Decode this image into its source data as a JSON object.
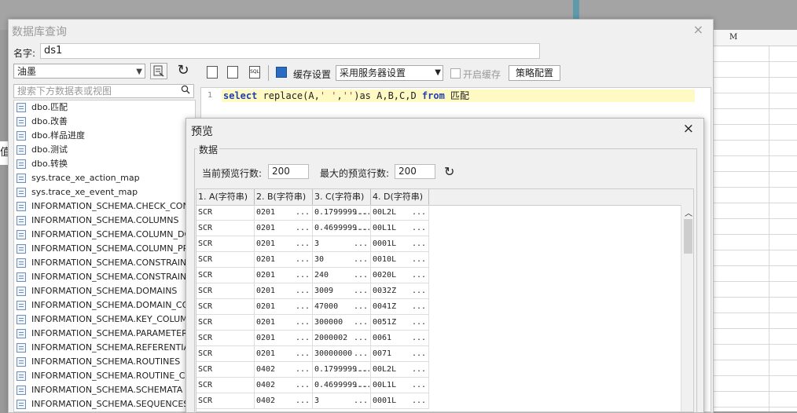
{
  "background": {
    "sheet_column_label": "M",
    "left_edge_text": "值"
  },
  "main_dialog": {
    "title": "数据库查询",
    "close_glyph": "×",
    "name_label": "名字:",
    "name_value": "ds1"
  },
  "left_panel": {
    "db_selected": "油墨",
    "search_placeholder": "搜索下方数据表或视图",
    "tables": [
      "dbo.匹配",
      "dbo.改善",
      "dbo.样品进度",
      "dbo.测试",
      "dbo.转换",
      "sys.trace_xe_action_map",
      "sys.trace_xe_event_map",
      "INFORMATION_SCHEMA.CHECK_CONSTRAINTS",
      "INFORMATION_SCHEMA.COLUMNS",
      "INFORMATION_SCHEMA.COLUMN_DOMAIN_USAGE",
      "INFORMATION_SCHEMA.COLUMN_PRIVILEGES",
      "INFORMATION_SCHEMA.CONSTRAINT_COLUMN_USAGE",
      "INFORMATION_SCHEMA.CONSTRAINT_TABLE_USAGE",
      "INFORMATION_SCHEMA.DOMAINS",
      "INFORMATION_SCHEMA.DOMAIN_CONSTRAINTS",
      "INFORMATION_SCHEMA.KEY_COLUMN_USAGE",
      "INFORMATION_SCHEMA.PARAMETERS",
      "INFORMATION_SCHEMA.REFERENTIAL_CONSTRAINTS",
      "INFORMATION_SCHEMA.ROUTINES",
      "INFORMATION_SCHEMA.ROUTINE_COLUMNS",
      "INFORMATION_SCHEMA.SCHEMATA",
      "INFORMATION_SCHEMA.SEQUENCES"
    ]
  },
  "toolbar": {
    "cache_label": "缓存设置",
    "cache_option": "采用服务器设置",
    "enable_cache_label": "开启缓存",
    "strategy_button": "策略配置"
  },
  "editor": {
    "line_number": "1",
    "sql_kw_select": "select",
    "sql_mid": " replace(A,",
    "sql_str1": "' '",
    "sql_comma": ",",
    "sql_str2": "''",
    "sql_tail": ")as A,B,C,D ",
    "sql_kw_from": "from",
    "sql_table": " 匹配"
  },
  "preview": {
    "title": "预览",
    "close_glyph": "×",
    "group_title": "数据",
    "current_rows_label": "当前预览行数:",
    "current_rows_value": "200",
    "max_rows_label": "最大的预览行数:",
    "max_rows_value": "200",
    "columns": [
      "1. A(字符串)",
      "2. B(字符串)",
      "3. C(字符串)",
      "4. D(字符串)"
    ],
    "rows": [
      [
        "SCR",
        "0201",
        "0.1799999...",
        "00L2L"
      ],
      [
        "SCR",
        "0201",
        "0.4699999...",
        "00L1L"
      ],
      [
        "SCR",
        "0201",
        "3",
        "0001L"
      ],
      [
        "SCR",
        "0201",
        "30",
        "0010L"
      ],
      [
        "SCR",
        "0201",
        "240",
        "0020L"
      ],
      [
        "SCR",
        "0201",
        "3009",
        "0032Z"
      ],
      [
        "SCR",
        "0201",
        "47000",
        "0041Z"
      ],
      [
        "SCR",
        "0201",
        "300000",
        "0051Z"
      ],
      [
        "SCR",
        "0201",
        "2000002",
        "0061"
      ],
      [
        "SCR",
        "0201",
        "30000000",
        "0071"
      ],
      [
        "SCR",
        "0402",
        "0.1799999...",
        "00L2L"
      ],
      [
        "SCR",
        "0402",
        "0.4699999...",
        "00L1L"
      ],
      [
        "SCR",
        "0402",
        "3",
        "0001L"
      ]
    ]
  }
}
